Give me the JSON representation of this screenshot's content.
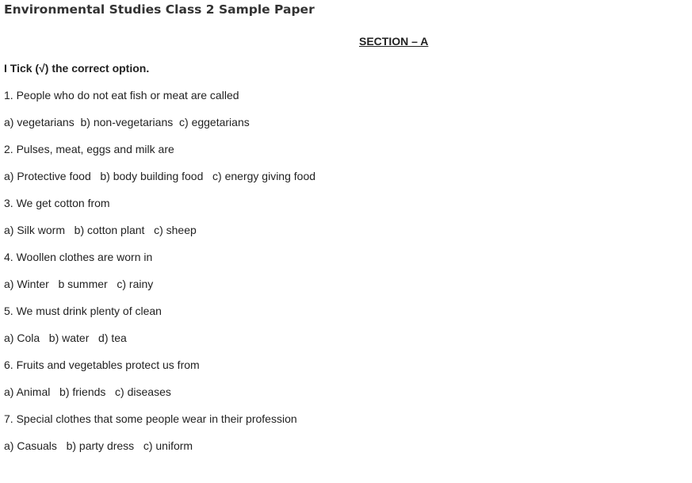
{
  "document": {
    "title": "Environmental Studies Class 2 Sample Paper",
    "section_heading": "SECTION – A",
    "instruction": "I Tick (√) the correct option.",
    "questions": [
      {
        "question": "1. People who do not eat fish or meat are called",
        "options": "a) vegetarians  b) non-vegetarians  c) eggetarians"
      },
      {
        "question": "2. Pulses, meat, eggs and milk are",
        "options": "a) Protective food   b) body building food   c) energy giving food"
      },
      {
        "question": "3. We get cotton from",
        "options": "a) Silk worm   b) cotton plant   c) sheep"
      },
      {
        "question": "4. Woollen clothes are worn in",
        "options": "a) Winter   b summer   c) rainy"
      },
      {
        "question": "5. We must drink plenty of clean",
        "options": "a) Cola   b) water   d) tea"
      },
      {
        "question": "6. Fruits and vegetables protect us from",
        "options": "a) Animal   b) friends   c) diseases"
      },
      {
        "question": "7. Special clothes that some people wear in their profession",
        "options": "a) Casuals   b) party dress   c) uniform"
      }
    ]
  }
}
